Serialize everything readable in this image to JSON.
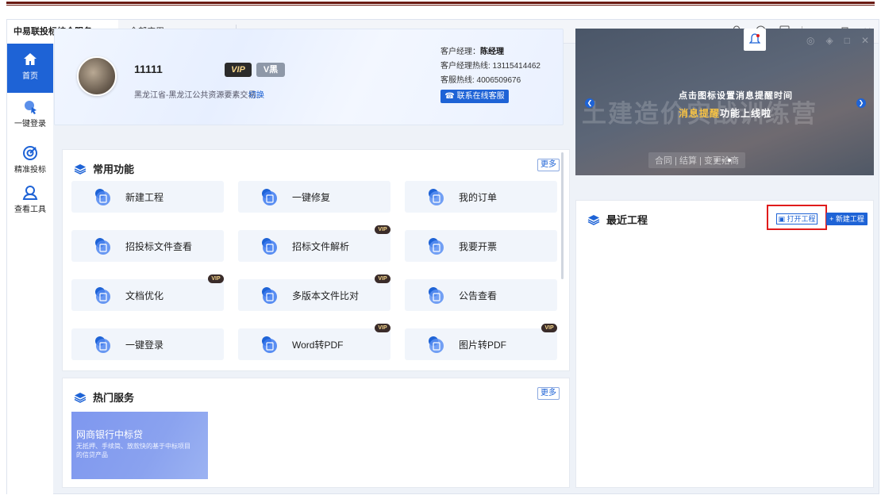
{
  "titlebar": {
    "tab_active": "中易联投标综合服务...",
    "tab_apps": "全部应用",
    "icons": [
      "bell-icon",
      "settings-icon",
      "skin-icon",
      "minimize-icon",
      "restore-icon",
      "close-icon"
    ]
  },
  "sidebar": {
    "items": [
      {
        "label": "首页",
        "icon": "home-icon",
        "active": true
      },
      {
        "label": "一键登录",
        "icon": "login-icon"
      },
      {
        "label": "精准投标",
        "icon": "target-icon"
      },
      {
        "label": "查看工具",
        "icon": "user-search-icon"
      }
    ]
  },
  "profile": {
    "username": "11111",
    "vip": "VIP",
    "vip_type": "V黑",
    "region": "黑龙江省-黑龙江公共资源要素交易...",
    "switch": "切换",
    "manager_label": "客户经理：",
    "manager_name": "陈经理",
    "hotline": "客户经理热线: 13115414462",
    "service": "客服热线: 4006509676",
    "contact_button": "联系在线客服"
  },
  "common_functions": {
    "title": "常用功能",
    "more": "更多",
    "items": [
      {
        "label": "新建工程",
        "vip": false
      },
      {
        "label": "一键修复",
        "vip": false
      },
      {
        "label": "我的订单",
        "vip": false
      },
      {
        "label": "招投标文件查看",
        "vip": false
      },
      {
        "label": "招标文件解析",
        "vip": true
      },
      {
        "label": "我要开票",
        "vip": false
      },
      {
        "label": "文档优化",
        "vip": true
      },
      {
        "label": "多版本文件比对",
        "vip": true
      },
      {
        "label": "公告查看",
        "vip": false
      },
      {
        "label": "一键登录",
        "vip": false
      },
      {
        "label": "Word转PDF",
        "vip": true
      },
      {
        "label": "图片转PDF",
        "vip": true
      }
    ],
    "vip_tag": "VIP"
  },
  "hot_services": {
    "title": "热门服务",
    "more": "更多",
    "promo_title": "网商银行中标贷",
    "promo_sub": "无抵押、手续简、放款快的基于中标项目的信贷产品"
  },
  "banner": {
    "line1": "点击图标设置消息提醒时间",
    "line2_highlight": "消息提醒",
    "line2_rest": "功能上线啦",
    "bg_text": "土建造价实战训练营",
    "tabs_text": "合同 | 结算 | 变更洽商"
  },
  "recent": {
    "title": "最近工程",
    "open_button": "打开工程",
    "new_button": "+ 新建工程"
  },
  "colors": {
    "primary": "#1e63d6",
    "highlight_box": "#e01b1b",
    "vip_gold": "#f6d68b"
  }
}
